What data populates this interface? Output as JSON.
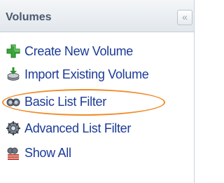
{
  "panel": {
    "title": "Volumes",
    "collapse_glyph": "«"
  },
  "menu": {
    "items": [
      {
        "label": "Create New Volume",
        "icon": "plus-icon"
      },
      {
        "label": "Import Existing Volume",
        "icon": "import-icon"
      },
      {
        "label": "Basic List Filter",
        "icon": "filter-icon",
        "highlighted": true
      },
      {
        "label": "Advanced List Filter",
        "icon": "advanced-filter-icon"
      },
      {
        "label": "Show All",
        "icon": "show-all-icon"
      }
    ]
  },
  "colors": {
    "link": "#1b3a96",
    "highlight": "#f08a26",
    "header_text": "#4a5a6e"
  }
}
